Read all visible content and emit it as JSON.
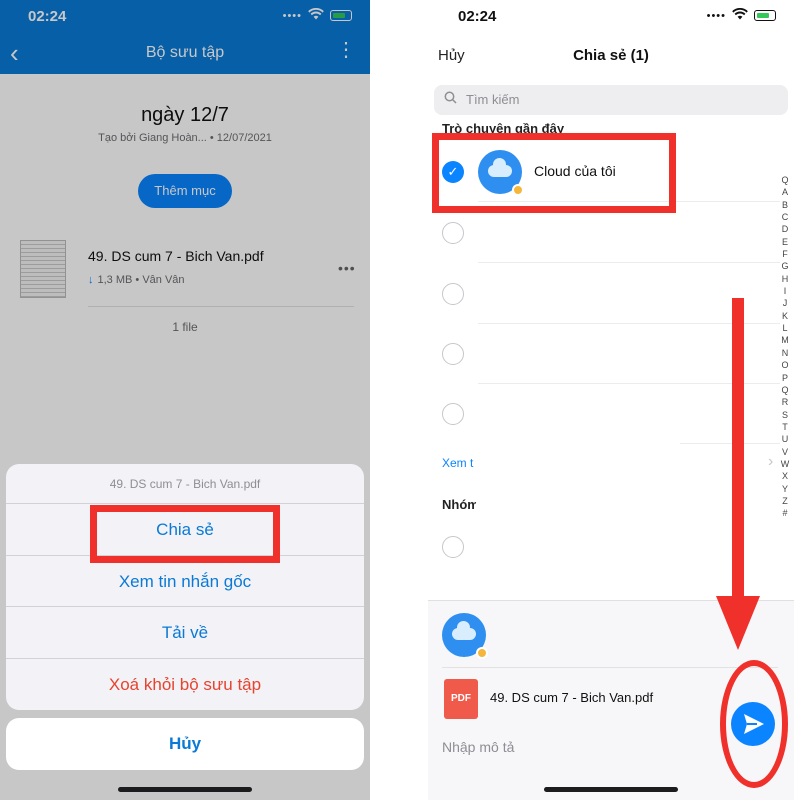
{
  "left_phone": {
    "status": {
      "time": "02:24"
    },
    "header": {
      "title": "Bộ sưu tập"
    },
    "collection": {
      "title": "ngày 12/7",
      "subtitle": "Tạo bởi Giang Hoàn... • 12/07/2021",
      "add_button": "Thêm mục"
    },
    "file": {
      "name": "49. DS cum 7 - Bich Van.pdf",
      "size": "1,3 MB",
      "owner": "• Vân Vân"
    },
    "file_count": "1 file",
    "action_sheet": {
      "title": "49. DS cum 7 - Bich Van.pdf",
      "items": [
        "Chia sẻ",
        "Xem tin nhắn gốc",
        "Tải về",
        "Xoá khỏi bộ sưu tập"
      ],
      "cancel": "Hủy"
    }
  },
  "right_phone": {
    "status": {
      "time": "02:24"
    },
    "header": {
      "cancel": "Hủy",
      "title": "Chia sẻ (1)"
    },
    "search": {
      "placeholder": "Tìm kiếm"
    },
    "recent_label": "Trò chuyện gần đây",
    "recent": [
      {
        "name": "Cloud của tôi",
        "checked": true
      }
    ],
    "see_more": "Xem t",
    "groups_label": "Nhóm",
    "index_letters": [
      "Q",
      "A",
      "B",
      "C",
      "D",
      "E",
      "F",
      "G",
      "H",
      "I",
      "J",
      "K",
      "L",
      "M",
      "N",
      "O",
      "P",
      "Q",
      "R",
      "S",
      "T",
      "U",
      "V",
      "W",
      "X",
      "Y",
      "Z",
      "#"
    ],
    "composer": {
      "file_type": "PDF",
      "file_name": "49. DS cum 7 - Bich Van.pdf",
      "caption_placeholder": "Nhập mô tả"
    }
  },
  "colors": {
    "header_blue": "#0a7ad6",
    "accent": "#0a84ff",
    "destructive": "#e8432d",
    "annotation_red": "#f0302a"
  }
}
